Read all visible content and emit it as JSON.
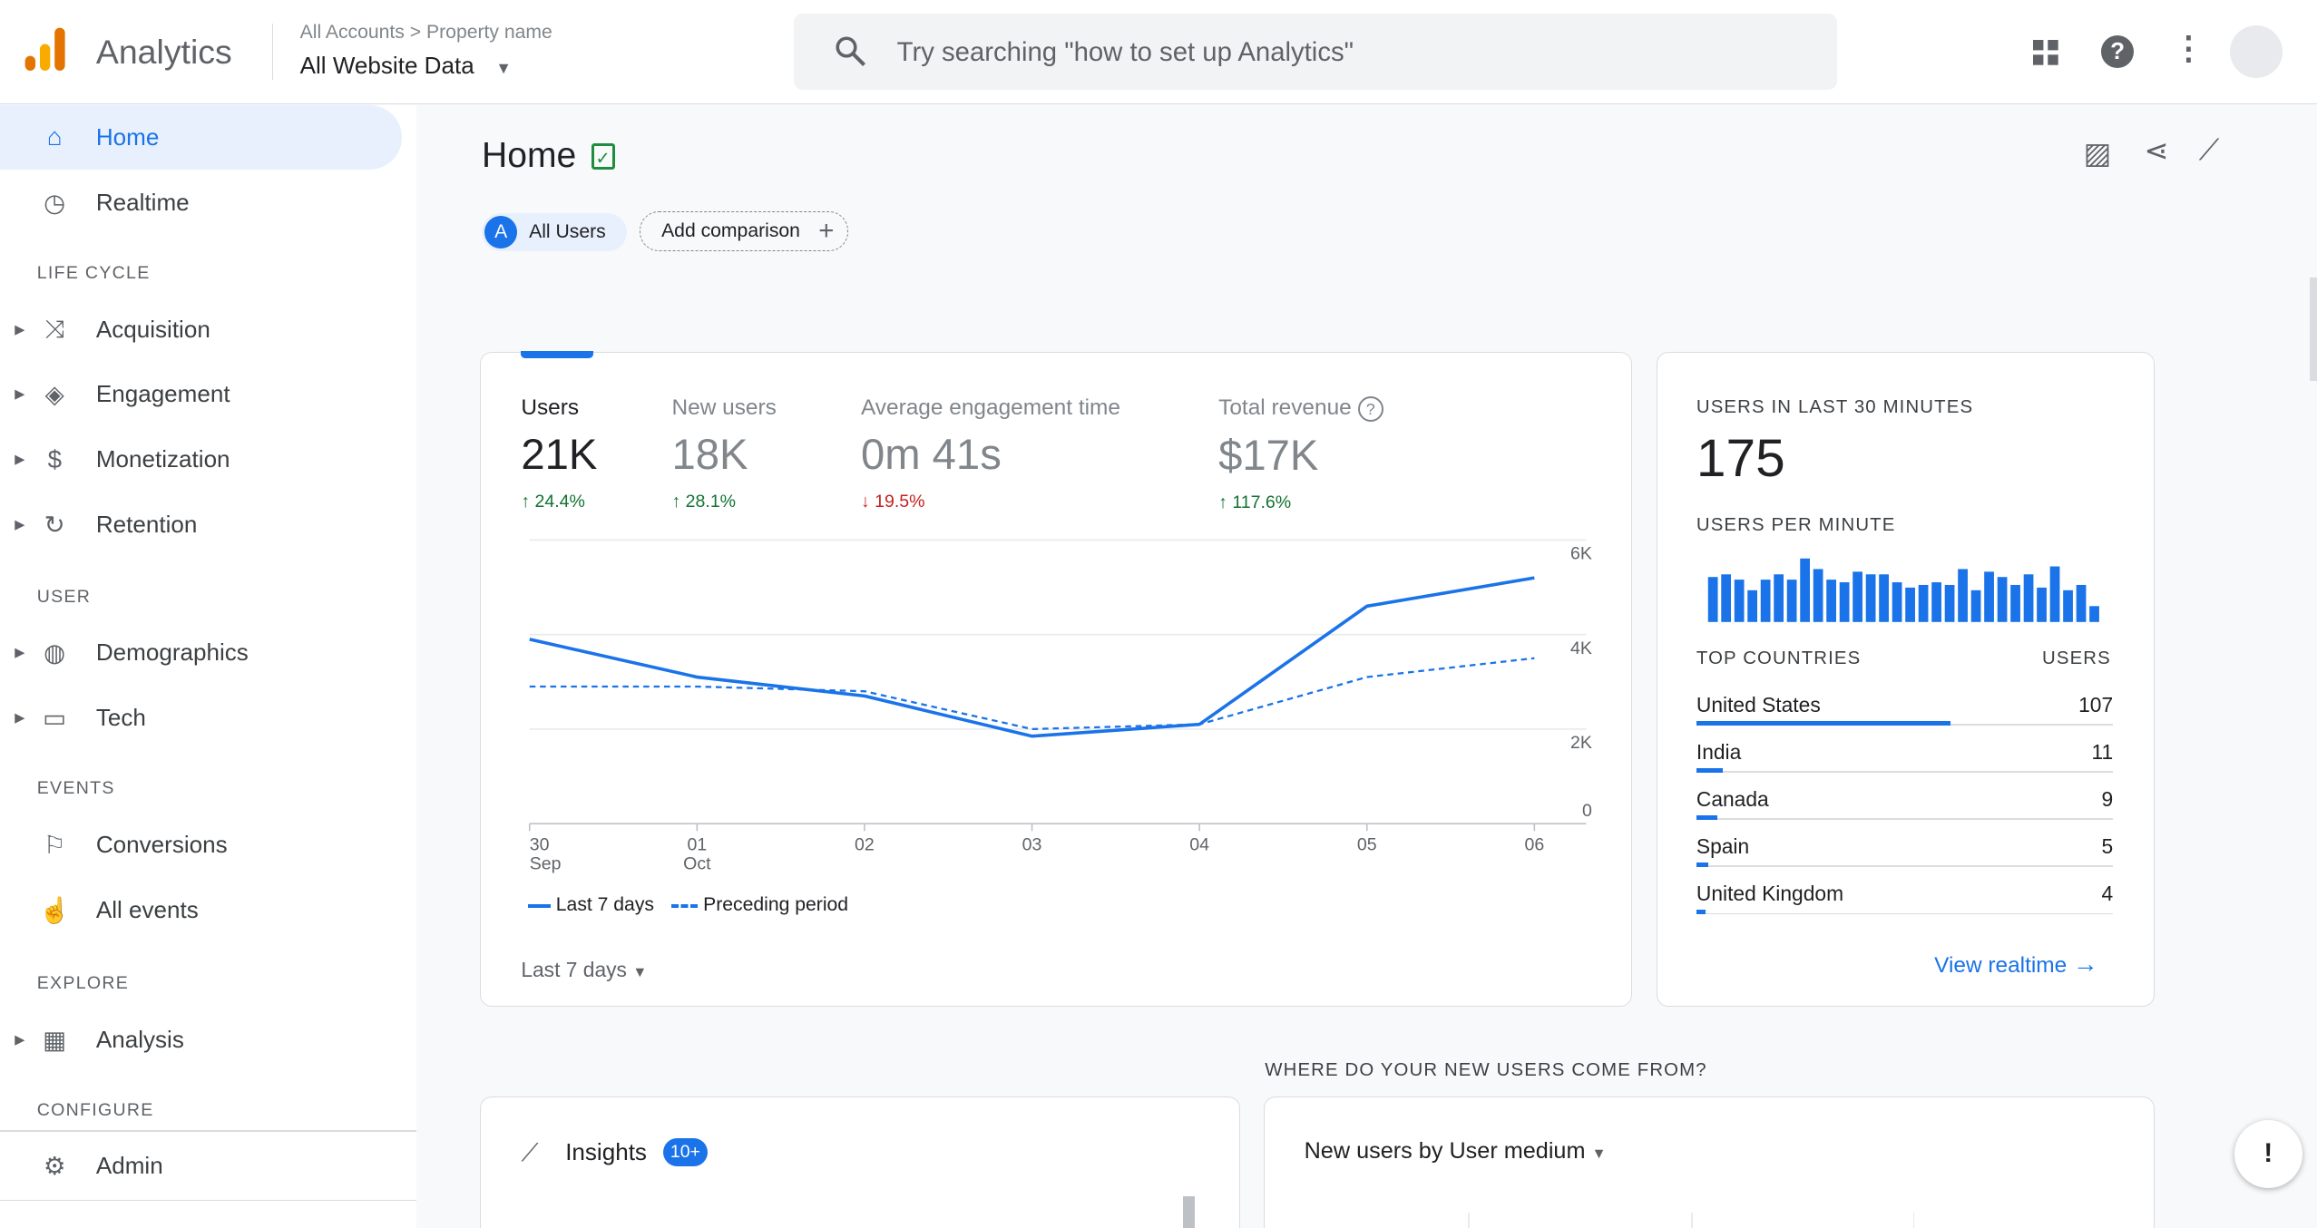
{
  "header": {
    "app_name": "Analytics",
    "breadcrumb": [
      "All Accounts",
      "Property name"
    ],
    "property": "All Website Data",
    "search_placeholder": "Try searching \"how to set up Analytics\""
  },
  "sidebar": {
    "items": [
      {
        "label": "Home",
        "icon": "home-icon",
        "active": true
      },
      {
        "label": "Realtime",
        "icon": "clock-icon"
      }
    ],
    "sections": [
      {
        "title": "LIFE CYCLE",
        "items": [
          {
            "label": "Acquisition",
            "icon": "acquisition-icon"
          },
          {
            "label": "Engagement",
            "icon": "tag-icon"
          },
          {
            "label": "Monetization",
            "icon": "dollar-icon"
          },
          {
            "label": "Retention",
            "icon": "retention-icon"
          }
        ]
      },
      {
        "title": "USER",
        "items": [
          {
            "label": "Demographics",
            "icon": "globe-icon"
          },
          {
            "label": "Tech",
            "icon": "devices-icon"
          }
        ]
      },
      {
        "title": "EVENTS",
        "items": [
          {
            "label": "Conversions",
            "icon": "flag-icon"
          },
          {
            "label": "All events",
            "icon": "touch-icon"
          }
        ]
      },
      {
        "title": "EXPLORE",
        "items": [
          {
            "label": "Analysis",
            "icon": "analysis-icon"
          }
        ]
      },
      {
        "title": "CONFIGURE",
        "items": [
          {
            "label": "Admin",
            "icon": "gear-icon"
          }
        ]
      }
    ]
  },
  "page": {
    "title": "Home",
    "segment_letter": "A",
    "segment": "All Users",
    "add_comparison": "Add comparison"
  },
  "metrics": [
    {
      "label": "Users",
      "value": "21K",
      "change": "24.4%",
      "direction": "up"
    },
    {
      "label": "New users",
      "value": "18K",
      "change": "28.1%",
      "direction": "up"
    },
    {
      "label": "Average engagement time",
      "value": "0m 41s",
      "change": "19.5%",
      "direction": "down"
    },
    {
      "label": "Total revenue",
      "value": "$17K",
      "change": "117.6%",
      "direction": "up"
    }
  ],
  "chart_data": [
    {
      "type": "line",
      "x": [
        "30 Sep",
        "01 Oct",
        "02",
        "03",
        "04",
        "05",
        "06"
      ],
      "x_tick_labels": [
        [
          "30",
          "Sep"
        ],
        [
          "01",
          "Oct"
        ],
        [
          "02",
          ""
        ],
        [
          "03",
          ""
        ],
        [
          "04",
          ""
        ],
        [
          "05",
          ""
        ],
        [
          "06",
          ""
        ]
      ],
      "y_tick_labels": [
        "0",
        "2K",
        "4K",
        "6K"
      ],
      "ylim": [
        0,
        6000
      ],
      "y_axis_side": "right",
      "grid": true,
      "series": [
        {
          "name": "Last 7 days",
          "style": "solid",
          "color": "#1a73e8",
          "values": [
            3900,
            3100,
            2700,
            1850,
            2100,
            4600,
            5200
          ]
        },
        {
          "name": "Preceding period",
          "style": "dashed",
          "color": "#1a73e8",
          "values": [
            2900,
            2900,
            2800,
            2000,
            2100,
            3100,
            3500
          ]
        }
      ],
      "legend": "bottom-left"
    },
    {
      "type": "bar",
      "title": "USERS PER MINUTE",
      "color": "#1a73e8",
      "values": [
        17,
        18,
        16,
        12,
        16,
        18,
        16,
        24,
        20,
        16,
        15,
        19,
        18,
        18,
        15,
        13,
        14,
        15,
        14,
        20,
        12,
        19,
        17,
        14,
        18,
        13,
        21,
        12,
        14,
        6
      ]
    }
  ],
  "date_range": "Last 7 days",
  "realtime": {
    "title": "USERS IN LAST 30 MINUTES",
    "value": "175",
    "per_minute": "USERS PER MINUTE",
    "countries_header": "TOP COUNTRIES",
    "users_header": "USERS",
    "countries": [
      {
        "name": "United States",
        "users": 107
      },
      {
        "name": "India",
        "users": 11
      },
      {
        "name": "Canada",
        "users": 9
      },
      {
        "name": "Spain",
        "users": 5
      },
      {
        "name": "United Kingdom",
        "users": 4
      }
    ],
    "link": "View realtime"
  },
  "section_title": "WHERE DO YOUR NEW USERS COME FROM?",
  "insights": {
    "title": "Insights",
    "badge": "10+"
  },
  "new_users": {
    "title": "New users by User medium"
  }
}
